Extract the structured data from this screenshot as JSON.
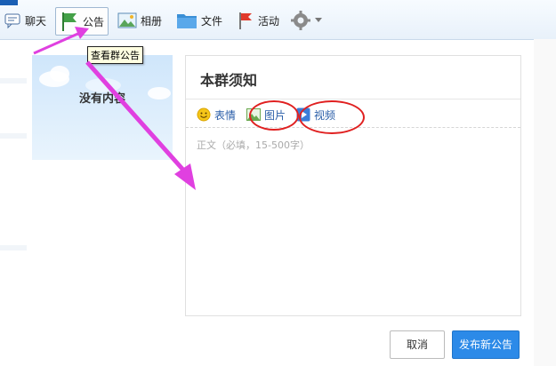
{
  "toolbar": {
    "items": [
      {
        "label": "聊天",
        "icon": "chat-icon"
      },
      {
        "label": "公告",
        "icon": "announcement-flag-icon",
        "active": true
      },
      {
        "label": "相册",
        "icon": "photo-album-icon"
      },
      {
        "label": "文件",
        "icon": "folder-icon"
      },
      {
        "label": "活动",
        "icon": "red-flag-icon"
      }
    ],
    "settings_icon": "gear-icon"
  },
  "tooltip": "查看群公告",
  "thumbnail": {
    "text": "没有内容"
  },
  "editor": {
    "title": "本群须知",
    "tools": [
      {
        "label": "表情",
        "icon": "emoji-icon"
      },
      {
        "label": "图片",
        "icon": "image-icon"
      },
      {
        "label": "视频",
        "icon": "video-icon"
      }
    ],
    "placeholder": "正文（必填，15-500字）"
  },
  "buttons": {
    "cancel": "取消",
    "publish": "发布新公告"
  },
  "colors": {
    "accent": "#2c8ae8",
    "annotation": "#e040e0",
    "circle": "#e02020"
  }
}
